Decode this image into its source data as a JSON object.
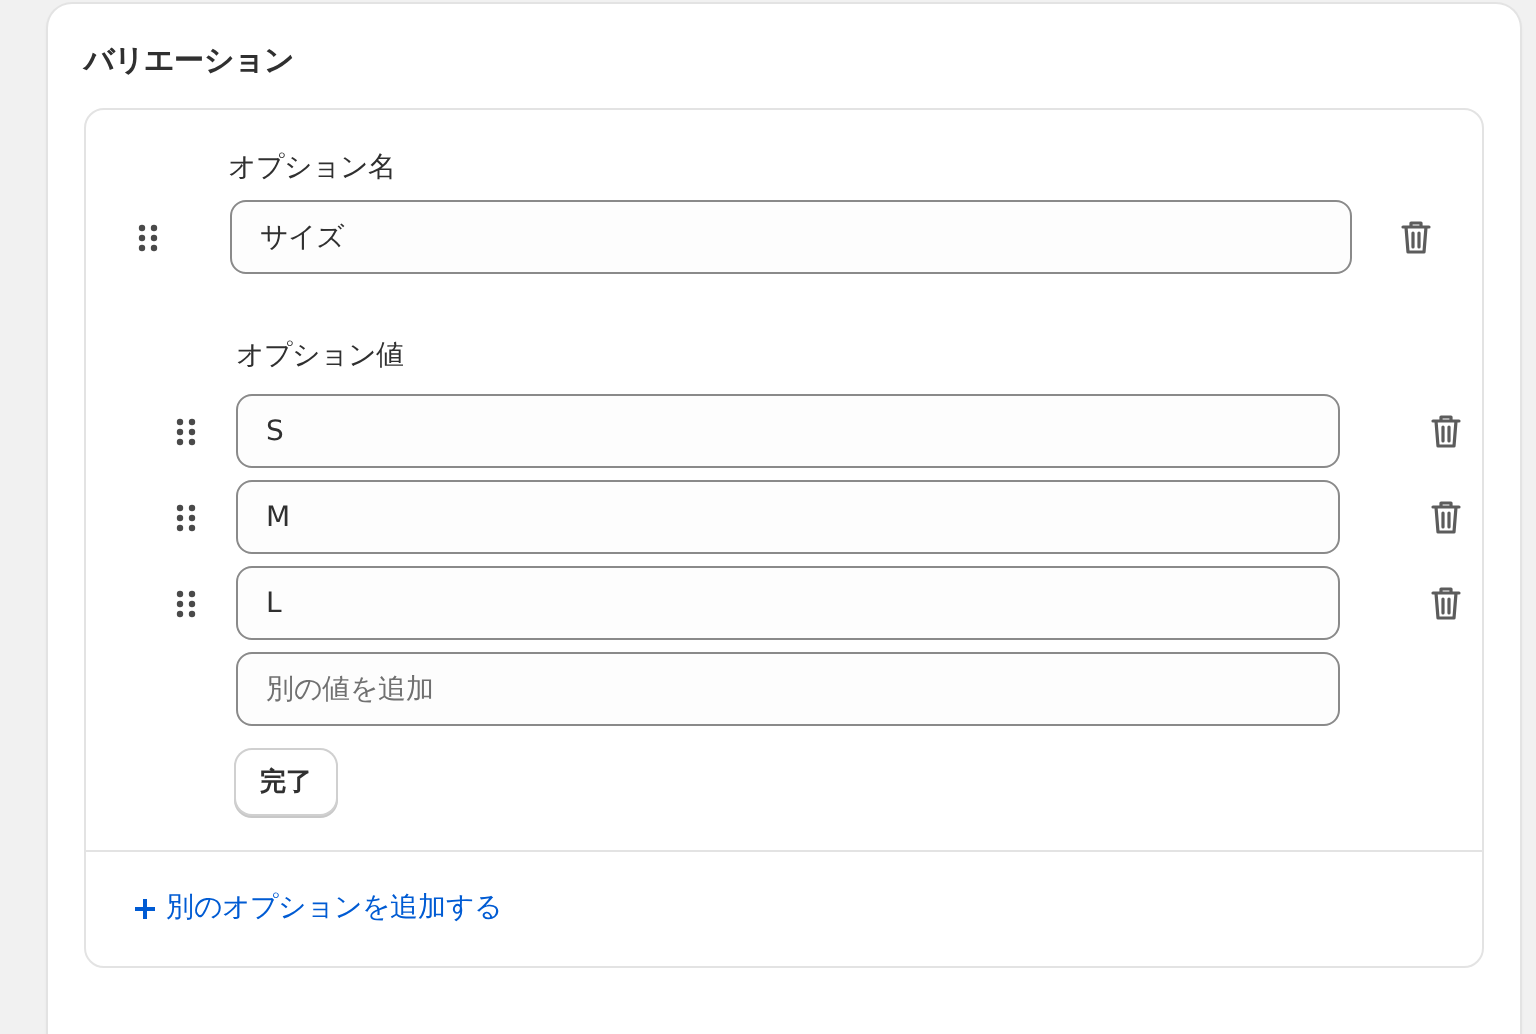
{
  "title": "バリエーション",
  "option_name": {
    "label": "オプション名",
    "value": "サイズ"
  },
  "option_values": {
    "label": "オプション値",
    "values": [
      {
        "value": "S"
      },
      {
        "value": "M"
      },
      {
        "value": "L"
      }
    ],
    "new_placeholder": "別の値を追加"
  },
  "done_button": "完了",
  "add_option_link": "別のオプションを追加する"
}
